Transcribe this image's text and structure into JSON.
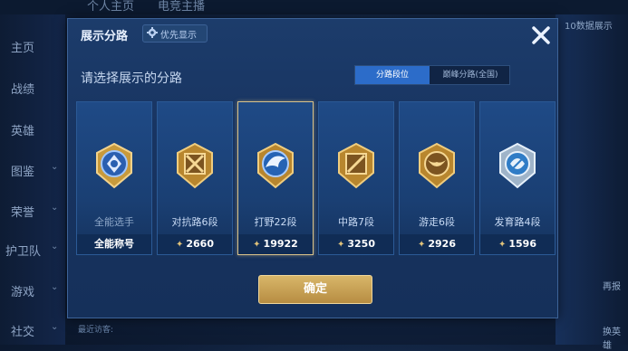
{
  "background": {
    "top_tabs": [
      "个人主页",
      "电竞主播"
    ],
    "sidebar": [
      "主页",
      "战绩",
      "英雄",
      "图鉴",
      "荣誉",
      "护卫队",
      "游戏",
      "社交"
    ],
    "right": {
      "top_label": "10数据展示",
      "btn1": "再报",
      "btn2": "换英雄"
    },
    "recent_label": "最近访客:"
  },
  "dialog": {
    "title": "展示分路",
    "priority_label": "优先显示",
    "subtitle": "请选择展示的分路",
    "toggle": {
      "active": "分路段位",
      "inactive": "巅峰分路(全国)"
    },
    "cards": [
      {
        "name": "全能选手",
        "foot": "全能称号",
        "selected": false,
        "emblem": "all-round-emblem"
      },
      {
        "name": "对抗路6段",
        "foot": "2660",
        "selected": false,
        "emblem": "clash-lane-emblem"
      },
      {
        "name": "打野22段",
        "foot": "19922",
        "selected": true,
        "emblem": "jungle-emblem"
      },
      {
        "name": "中路7段",
        "foot": "3250",
        "selected": false,
        "emblem": "mid-lane-emblem"
      },
      {
        "name": "游走6段",
        "foot": "2926",
        "selected": false,
        "emblem": "roam-emblem"
      },
      {
        "name": "发育路4段",
        "foot": "1596",
        "selected": false,
        "emblem": "farm-lane-emblem"
      }
    ],
    "confirm_label": "确定"
  },
  "colors": {
    "accent_gold": "#d8b669",
    "toggle_active": "#2c6cc9",
    "dialog_bg": "#1c3c6b"
  }
}
